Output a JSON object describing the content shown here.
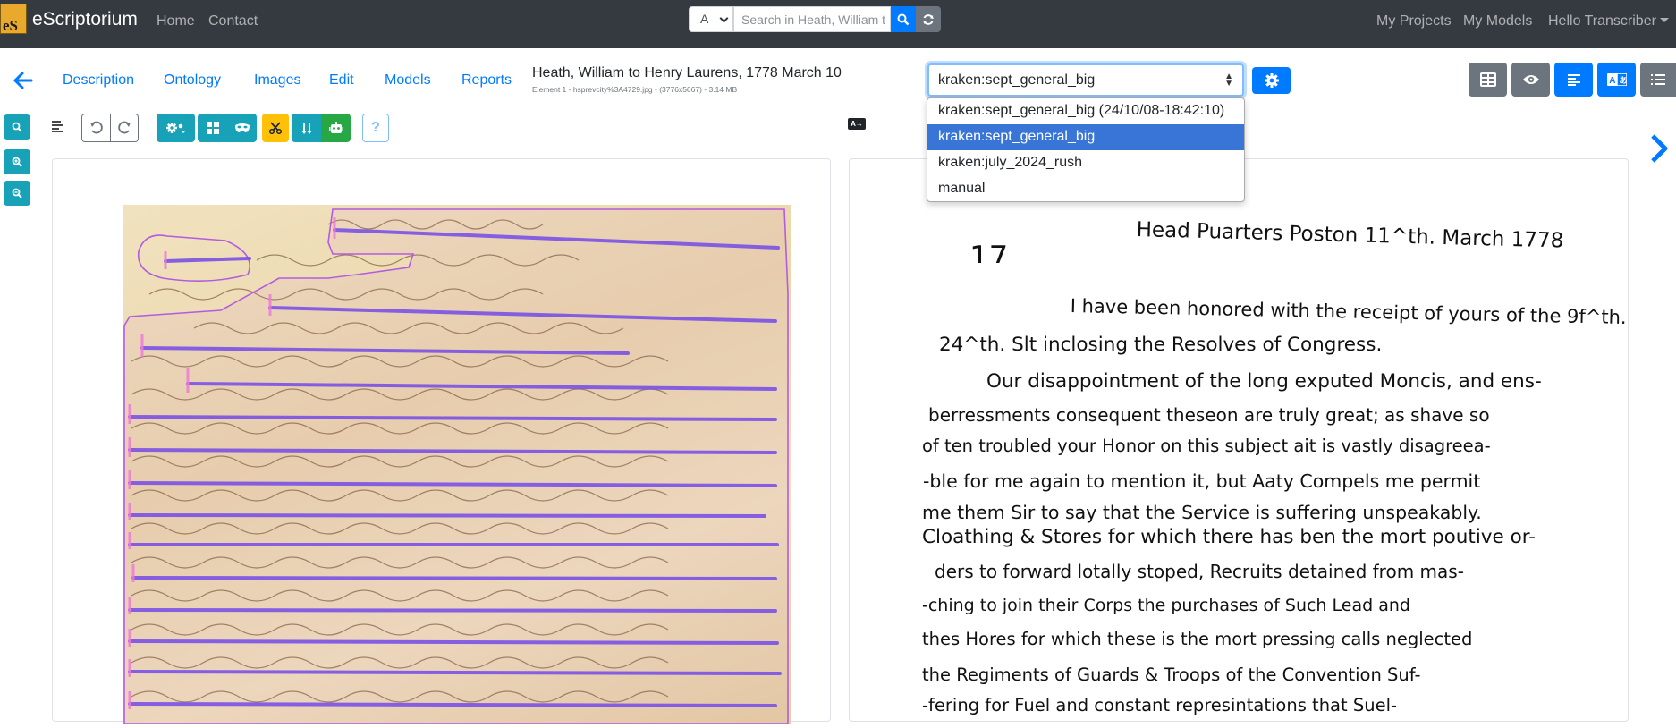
{
  "navbar": {
    "logo_text": "eS",
    "brand": "eScriptorium",
    "links": [
      "Home",
      "Contact"
    ],
    "search": {
      "scope": "A",
      "placeholder": "Search in Heath, William t"
    },
    "right_links": [
      "My Projects",
      "My Models"
    ],
    "user": "Hello Transcriber"
  },
  "tabs": [
    "Description",
    "Ontology",
    "Images",
    "Edit",
    "Models",
    "Reports"
  ],
  "document": {
    "title": "Heath, William to Henry Laurens, 1778 March 10",
    "meta": "Element 1 - hsprevcity%3A4729.jpg - (3776x5667) - 3.14 MB"
  },
  "transcription_select": {
    "value": "kraken:sept_general_big",
    "options": [
      "kraken:sept_general_big (24/10/08-18:42:10)",
      "kraken:sept_general_big",
      "kraken:july_2024_rush",
      "manual"
    ],
    "selected_index": 1
  },
  "colors": {
    "primary": "#007bff",
    "info": "#17a2b8",
    "warning": "#ffc107",
    "success": "#28a745",
    "secondary": "#6c757d",
    "navbar": "#343a40",
    "baseline": "#7b52e6"
  },
  "icons": {
    "toolbar": [
      "undo-icon",
      "redo-icon",
      "settings-icon",
      "segmentation-icon",
      "mask-icon",
      "cut-icon",
      "reorder-icon",
      "robot-icon",
      "help-icon"
    ],
    "right": [
      "grid-icon",
      "eye-icon",
      "text-lines-icon",
      "translate-icon",
      "list-ordered-icon"
    ]
  },
  "help_label": "?",
  "compare_label": "A→",
  "transcription_lines": [
    "Head Puarters Poston 11^th. March 1778",
    "17",
    "I have been honored with the receipt of yours of the 9f^th.",
    "24^th. Slt inclosing the Resolves of Congress.",
    "Our disappointment of the long exputed Moncis, and ens-",
    "berressments consequent theseon are truly great; as shave so",
    "of ten troubled your Honor on this subject ait is vastly disagreea-",
    "-ble for me again to mention it, but Aaty Compels me permit",
    "me them Sir to say that the Service is suffering unspeakably.",
    "Cloathing & Stores for which there has ben the mort poutive or-",
    "ders to forward lotally stoped, Recruits detained from mas-",
    "-ching to join their Corps the purchases of Such Lead and",
    "thes Hores for which these is the mort pressing calls neglected",
    "the Regiments of Guards & Troops of the Convention Suf-",
    "-fering for Fuel and constant represintations that Suel-"
  ]
}
